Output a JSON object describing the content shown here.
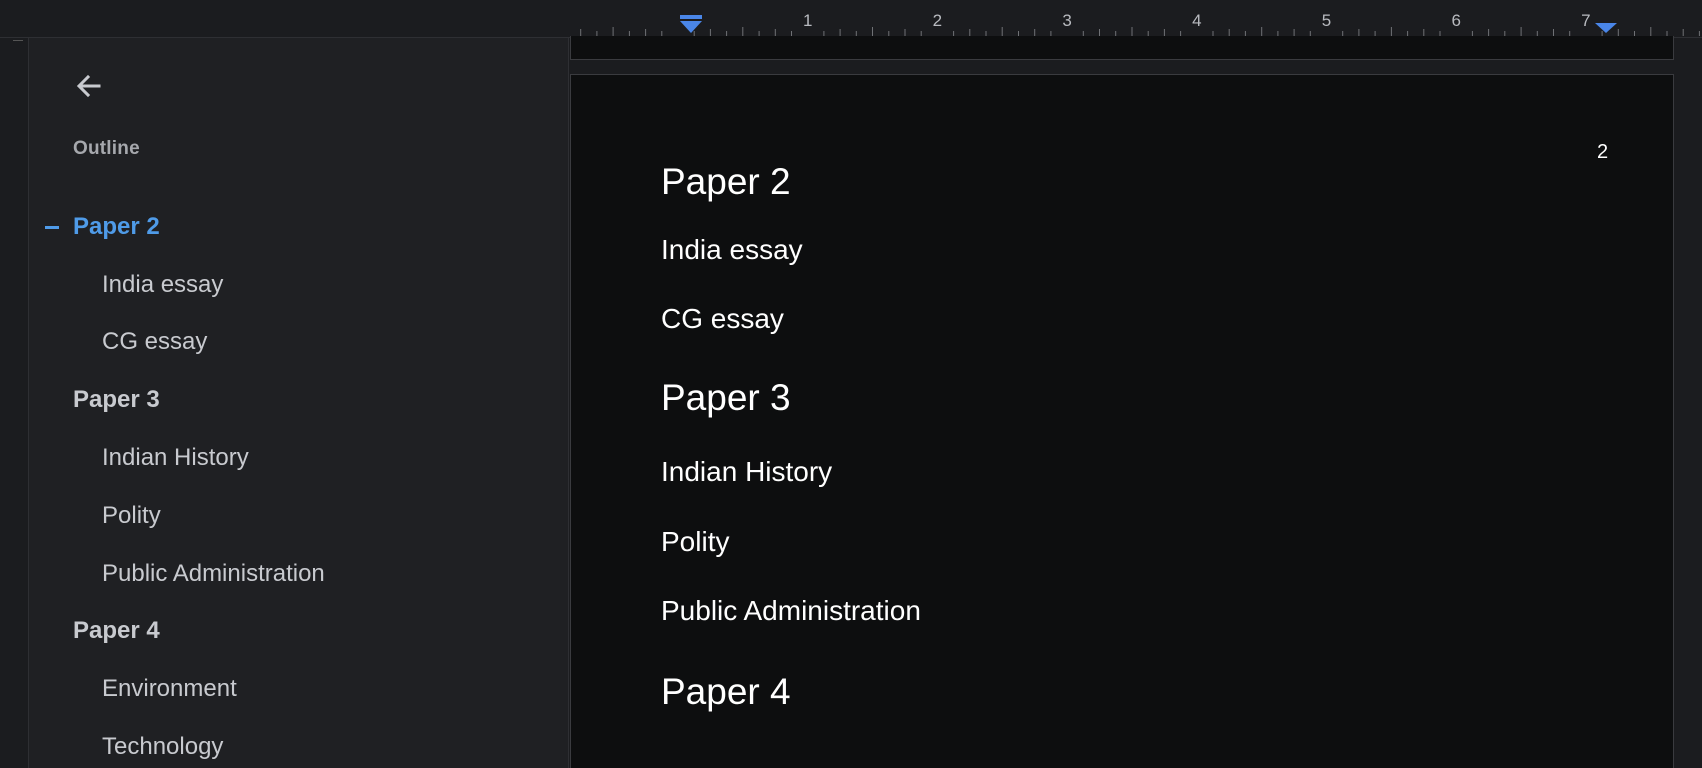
{
  "ruler": {
    "numbers": [
      "1",
      "2",
      "3",
      "4",
      "5",
      "6",
      "7"
    ],
    "marker_color": "#4a86e8"
  },
  "outline": {
    "title": "Outline",
    "items": [
      {
        "label": "Paper 2",
        "level": 1,
        "active": true
      },
      {
        "label": "India essay",
        "level": 2,
        "active": false
      },
      {
        "label": "CG essay",
        "level": 2,
        "active": false
      },
      {
        "label": "Paper 3",
        "level": 1,
        "active": false
      },
      {
        "label": "Indian History",
        "level": 2,
        "active": false
      },
      {
        "label": "Polity",
        "level": 2,
        "active": false
      },
      {
        "label": "Public Administration",
        "level": 2,
        "active": false
      },
      {
        "label": "Paper 4",
        "level": 1,
        "active": false
      },
      {
        "label": "Environment",
        "level": 2,
        "active": false
      },
      {
        "label": "Technology",
        "level": 2,
        "active": false
      }
    ],
    "active_color": "#4f9be8"
  },
  "document": {
    "page_number": "2",
    "lines": [
      {
        "text": "Paper 2",
        "style": "h1"
      },
      {
        "text": "India essay",
        "style": "h2"
      },
      {
        "text": "CG essay",
        "style": "h2"
      },
      {
        "text": "Paper 3",
        "style": "h1"
      },
      {
        "text": "Indian History",
        "style": "h2"
      },
      {
        "text": "Polity",
        "style": "h2"
      },
      {
        "text": "Public Administration",
        "style": "h2"
      },
      {
        "text": "Paper 4",
        "style": "h1"
      }
    ]
  },
  "icons": {
    "back": "arrow-left-icon"
  }
}
